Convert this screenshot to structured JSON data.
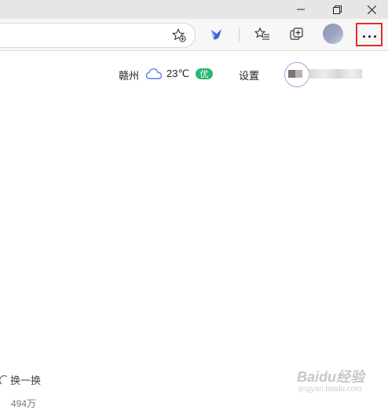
{
  "window_controls": {
    "minimize_icon": "minimize-icon",
    "restore_icon": "restore-icon",
    "close_icon": "close-icon"
  },
  "toolbar": {
    "favorite_add_icon": "star-plus-icon",
    "extension_icon": "bird-extension-icon",
    "favorites_icon": "favorites-list-icon",
    "collections_icon": "collections-icon",
    "more_icon": "more-options-icon",
    "highlight_color": "#e52b2b"
  },
  "header": {
    "city": "赣州",
    "weather_icon": "cloud-icon",
    "temperature": "23℃",
    "air_quality": "优",
    "air_quality_color": "#2bb673",
    "settings_label": "设置"
  },
  "feed": {
    "refresh_label": "换一换",
    "count": "494万"
  },
  "watermark": {
    "brand": "Baidu经验",
    "url": "jingyan.baidu.com"
  }
}
